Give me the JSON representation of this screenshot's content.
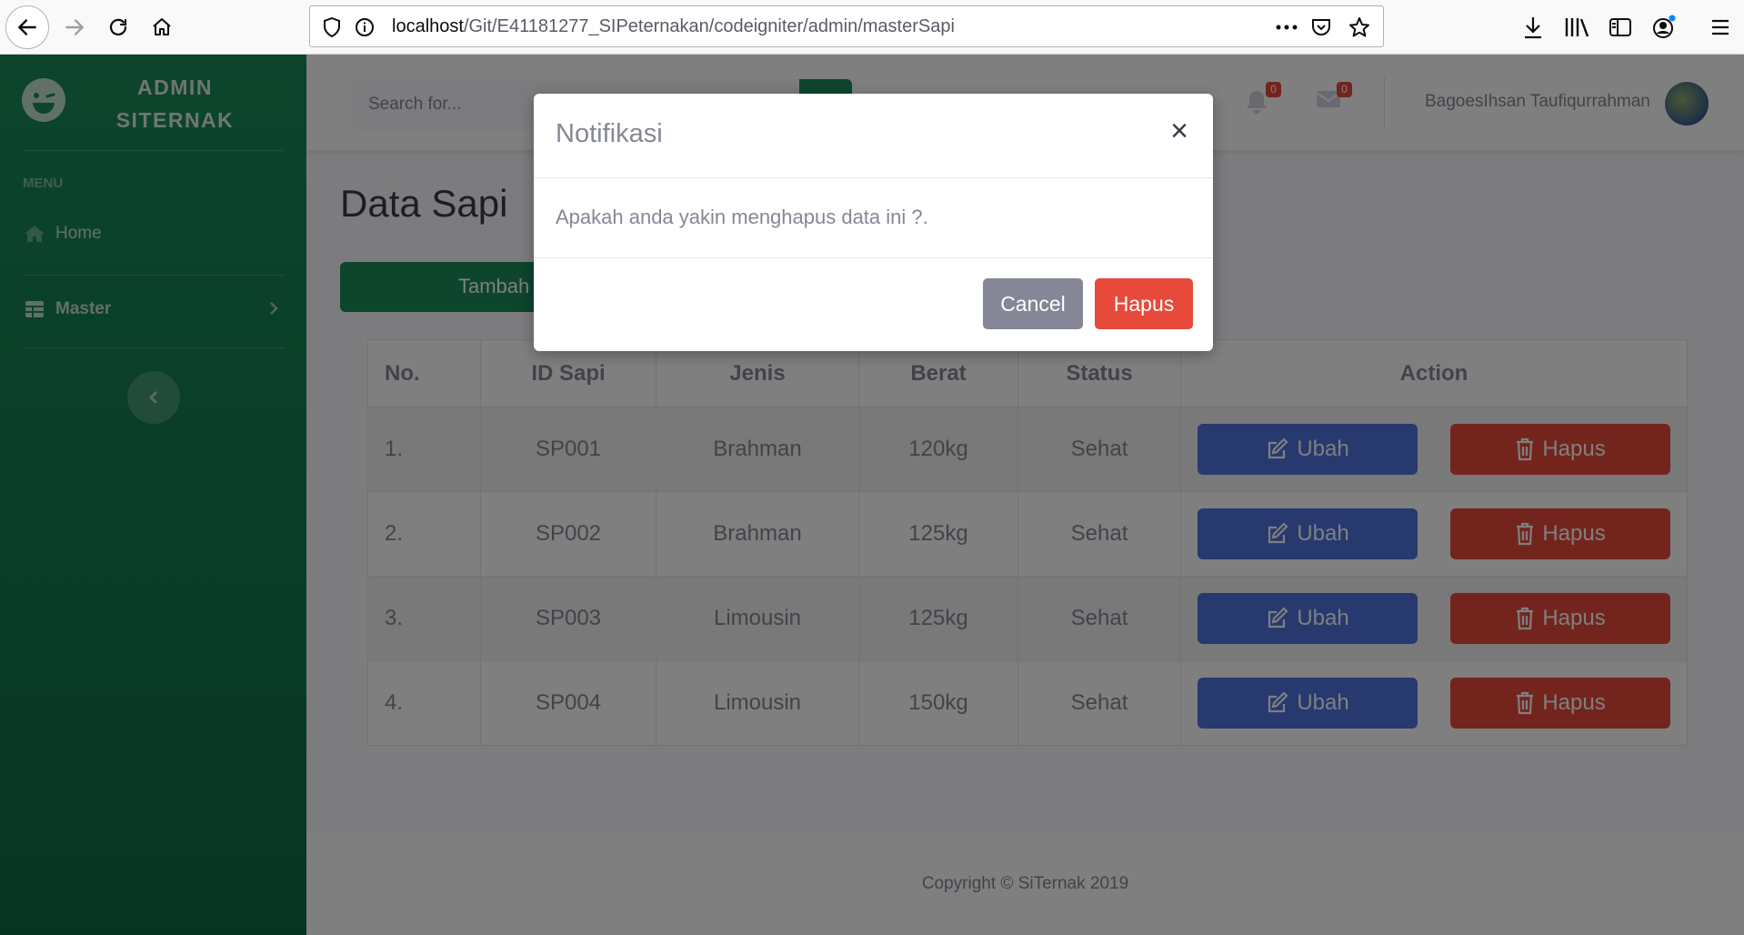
{
  "browser": {
    "url_host": "localhost",
    "url_path": "/Git/E41181277_SIPeternakan/codeigniter/admin/masterSapi"
  },
  "sidebar": {
    "brand_line1": "ADMIN",
    "brand_line2": "SITERNAK",
    "heading": "MENU",
    "items": [
      {
        "label": "Home",
        "icon": "home-icon"
      },
      {
        "label": "Master",
        "icon": "table-icon"
      }
    ]
  },
  "topbar": {
    "search_placeholder": "Search for...",
    "alerts_count": "0",
    "messages_count": "0",
    "user_name": "BagoesIhsan Taufiqurrahman"
  },
  "page": {
    "title": "Data Sapi",
    "add_button": "Tambah Data"
  },
  "table": {
    "headers": [
      "No.",
      "ID Sapi",
      "Jenis",
      "Berat",
      "Status",
      "Action"
    ],
    "rows": [
      {
        "no": "1.",
        "id": "SP001",
        "jenis": "Brahman",
        "berat": "120kg",
        "status": "Sehat"
      },
      {
        "no": "2.",
        "id": "SP002",
        "jenis": "Brahman",
        "berat": "125kg",
        "status": "Sehat"
      },
      {
        "no": "3.",
        "id": "SP003",
        "jenis": "Limousin",
        "berat": "125kg",
        "status": "Sehat"
      },
      {
        "no": "4.",
        "id": "SP004",
        "jenis": "Limousin",
        "berat": "150kg",
        "status": "Sehat"
      }
    ],
    "edit_label": "Ubah",
    "delete_label": "Hapus"
  },
  "footer": {
    "copyright": "Copyright © SiTernak 2019"
  },
  "modal": {
    "title": "Notifikasi",
    "close": "×",
    "message": "Apakah anda yakin menghapus data ini ?.",
    "cancel_label": "Cancel",
    "confirm_label": "Hapus"
  },
  "colors": {
    "sidebar": "#1a8a5a",
    "primary": "#4e73df",
    "danger": "#e74a3b",
    "secondary": "#858796"
  }
}
